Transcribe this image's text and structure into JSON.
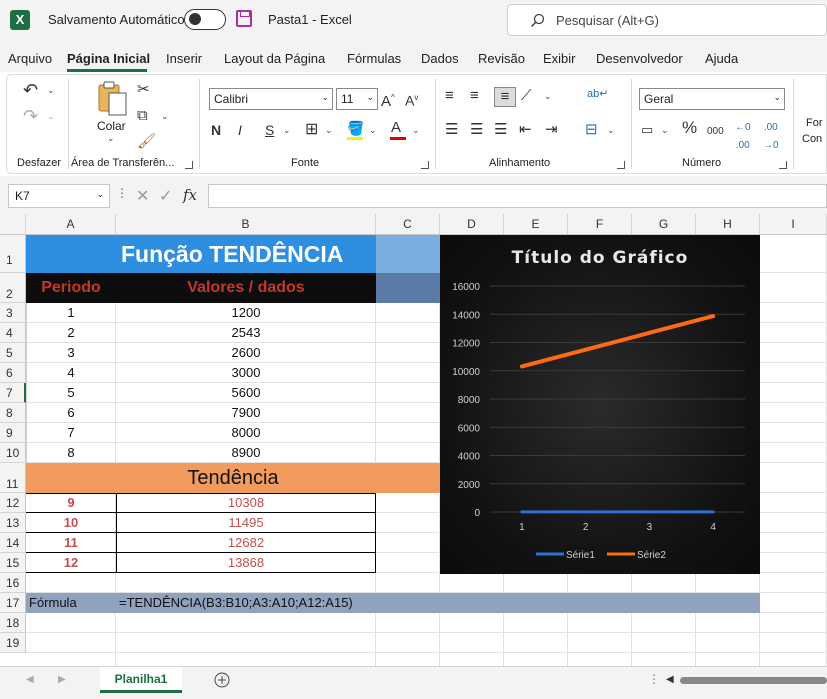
{
  "titlebar": {
    "app_logo": "X",
    "autosave_label": "Salvamento Automático",
    "doc_title": "Pasta1  -  Excel",
    "search_placeholder": "Pesquisar (Alt+G)"
  },
  "menu": {
    "tabs": [
      "Arquivo",
      "Página Inicial",
      "Inserir",
      "Layout da Página",
      "Fórmulas",
      "Dados",
      "Revisão",
      "Exibir",
      "Desenvolvedor",
      "Ajuda"
    ],
    "active": "Página Inicial"
  },
  "ribbon": {
    "groups": [
      "Desfazer",
      "Área de Transferên...",
      "Fonte",
      "Alinhamento",
      "Número"
    ],
    "paste_label": "Colar",
    "font_name": "Calibri",
    "font_size": "11",
    "number_format": "Geral",
    "bold": "N",
    "italic": "I",
    "underline": "S",
    "grow_font": "A",
    "shrink_font": "A",
    "percent": "%",
    "thousands": "000",
    "cut_label": "Formatação Condicional",
    "conditional_partial": "For",
    "conditional_partial2": "Con"
  },
  "formula_bar": {
    "name_box": "K7",
    "fx": "fx",
    "content": ""
  },
  "columns": [
    "A",
    "B",
    "C",
    "D",
    "E",
    "F",
    "G",
    "H",
    "I"
  ],
  "rows": [
    "1",
    "2",
    "3",
    "4",
    "5",
    "6",
    "7",
    "8",
    "9",
    "10",
    "11",
    "12",
    "13",
    "14",
    "15",
    "16",
    "17",
    "18",
    "19"
  ],
  "sheet": {
    "title": "Função TENDÊNCIA",
    "header_period": "Periodo",
    "header_values": "Valores / dados",
    "data": [
      {
        "p": "1",
        "v": "1200"
      },
      {
        "p": "2",
        "v": "2543"
      },
      {
        "p": "3",
        "v": "2600"
      },
      {
        "p": "4",
        "v": "3000"
      },
      {
        "p": "5",
        "v": "5600"
      },
      {
        "p": "6",
        "v": "7900"
      },
      {
        "p": "7",
        "v": "8000"
      },
      {
        "p": "8",
        "v": "8900"
      }
    ],
    "trend_title": "Tendência",
    "trend": [
      {
        "p": "9",
        "v": "10308"
      },
      {
        "p": "10",
        "v": "11495"
      },
      {
        "p": "11",
        "v": "12682"
      },
      {
        "p": "12",
        "v": "13868"
      }
    ],
    "formula_label": "Fórmula",
    "formula_text": "=TENDÊNCIA(B3:B10;A3:A10;A12:A15)"
  },
  "colors": {
    "excel_green": "#1d6f42",
    "title_blue": "#2e8fe0",
    "header_black": "#0d0d0d",
    "header_red": "#c0392b",
    "trend_orange": "#f29b5e",
    "trend_text": "#c0504d",
    "formula_bar": "#8fa3bf",
    "series1": "#2f6fd6",
    "series2": "#ff6a13"
  },
  "chart_data": {
    "type": "line",
    "title": "Título do Gráfico",
    "categories": [
      "1",
      "2",
      "3",
      "4"
    ],
    "series": [
      {
        "name": "Série1",
        "values": [
          9,
          10,
          11,
          12
        ]
      },
      {
        "name": "Série2",
        "values": [
          10308,
          11495,
          12682,
          13868
        ]
      }
    ],
    "ylim": [
      0,
      16000
    ],
    "yticks": [
      "0",
      "2000",
      "4000",
      "6000",
      "8000",
      "10000",
      "12000",
      "14000",
      "16000"
    ],
    "grid": true,
    "legend": "bottom"
  },
  "sheet_tabs": [
    "Planilha1"
  ]
}
